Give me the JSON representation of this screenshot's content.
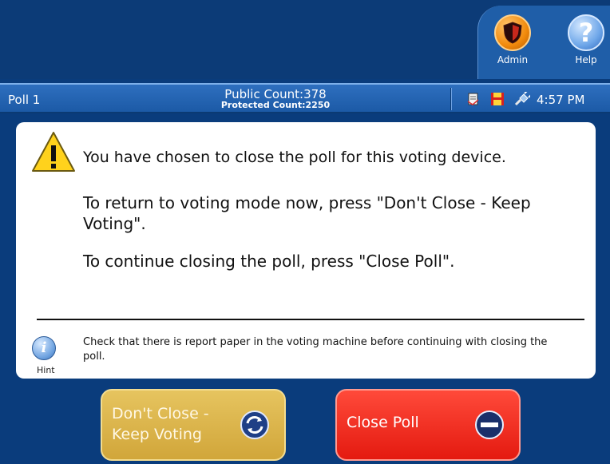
{
  "header": {
    "admin_label": "Admin",
    "help_label": "Help",
    "help_glyph": "?"
  },
  "status": {
    "poll_name": "Poll 1",
    "public_count_label": "Public Count:",
    "public_count": "378",
    "protected_count_label": "Protected Count:",
    "protected_count": "2250",
    "time": "4:57 PM",
    "icons": [
      "report-icon",
      "save-disk-icon",
      "power-plug-icon"
    ]
  },
  "message": {
    "line1": "You have chosen to close the poll for this voting device.",
    "line2": "To return to voting mode now, press \"Don't Close - Keep Voting\".",
    "line3": "To continue closing the poll, press \"Close Poll\"."
  },
  "hint": {
    "glyph": "i",
    "label": "Hint",
    "text": "Check that there is report paper in the voting machine before continuing with closing the poll."
  },
  "actions": {
    "keep_voting_label": "Don't Close - Keep Voting",
    "close_poll_label": "Close Poll"
  },
  "colors": {
    "background": "#0c3b77",
    "status_bar": "#1c5aa6",
    "keep_button": "#d9b24a",
    "close_button": "#f0281c",
    "admin_orange": "#f18a0c",
    "help_blue": "#6fa7e9"
  }
}
